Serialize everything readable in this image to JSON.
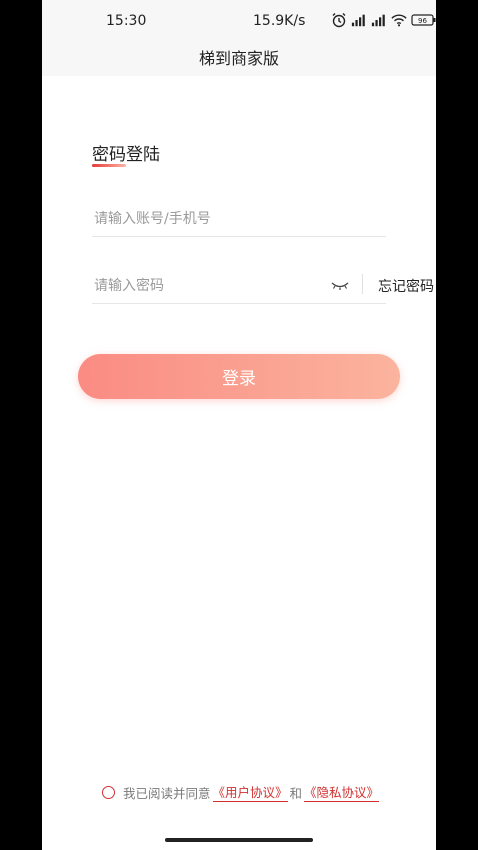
{
  "status_bar": {
    "time": "15:30",
    "network_speed": "15.9K/s",
    "battery": "96"
  },
  "header": {
    "title": "梯到商家版"
  },
  "login": {
    "section_title": "密码登陆",
    "account_placeholder": "请输入账号/手机号",
    "password_placeholder": "请输入密码",
    "forgot_password": "忘记密码",
    "login_button": "登录"
  },
  "agreement": {
    "prefix": "我已阅读并同意",
    "user_agreement": "《用户协议》",
    "and": "和",
    "privacy_policy": "《隐私协议》"
  },
  "colors": {
    "accent": "#d32f2f",
    "button_gradient_start": "#fa8b83",
    "button_gradient_end": "#fbb49e"
  },
  "icons": [
    "alarm-icon",
    "signal-icon",
    "signal-icon-2",
    "wifi-icon",
    "battery-icon",
    "eye-closed-icon",
    "radio-unchecked-icon"
  ]
}
